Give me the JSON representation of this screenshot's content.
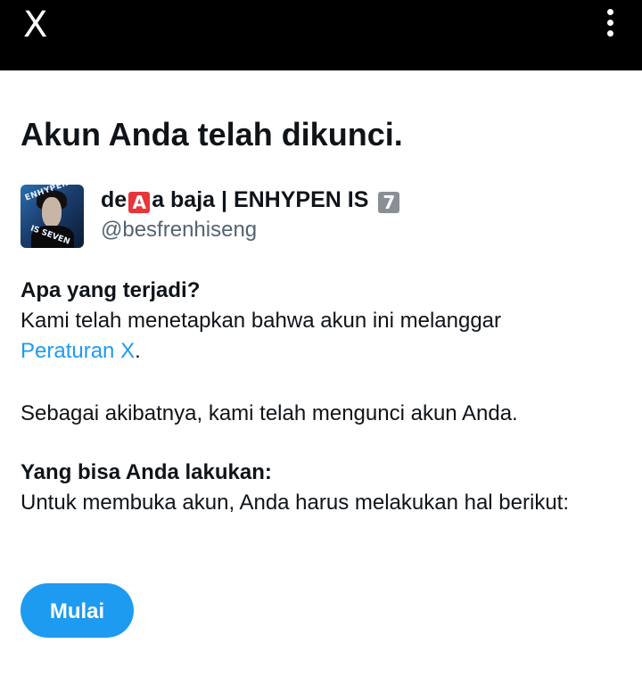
{
  "topbar": {
    "close_label": "X",
    "menu_icon": "more-vertical-icon"
  },
  "page": {
    "title": "Akun Anda telah dikunci."
  },
  "profile": {
    "display_name_part1": "de",
    "emoji_red": "A",
    "display_name_part2": "a baja | ENHYPEN IS ",
    "emoji_gray": "7",
    "handle": "@besfrenhiseng",
    "avatar_text_top": "ENHYPEN",
    "avatar_text_bottom": "IS SEVEN"
  },
  "what_happened": {
    "heading": "Apa yang terjadi?",
    "text": "Kami telah menetapkan bahwa akun ini melanggar",
    "link_text": "Peraturan X",
    "link_suffix": "."
  },
  "consequence": {
    "text": "Sebagai akibatnya, kami telah mengunci akun Anda."
  },
  "what_you_can_do": {
    "heading": "Yang bisa Anda lakukan:",
    "text": "Untuk membuka akun, Anda harus melakukan hal berikut:"
  },
  "cta": {
    "label": "Mulai"
  },
  "colors": {
    "accent": "#1d9bf0",
    "topbar": "#000000",
    "text": "#0f1419",
    "secondary": "#536471"
  }
}
